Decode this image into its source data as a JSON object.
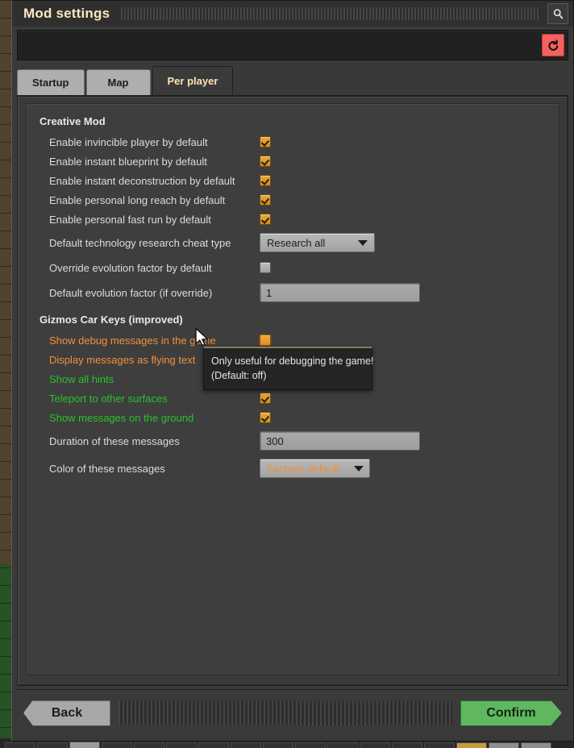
{
  "window": {
    "title": "Mod settings",
    "search_icon": "search-icon",
    "reset_icon": "reset-undo-icon"
  },
  "tabs": [
    {
      "label": "Startup",
      "active": false
    },
    {
      "label": "Map",
      "active": false
    },
    {
      "label": "Per player",
      "active": true
    }
  ],
  "groups": [
    {
      "title": "Creative Mod",
      "settings": [
        {
          "label": "Enable invincible player by default",
          "type": "checkbox",
          "state": "checked",
          "color": "default"
        },
        {
          "label": "Enable instant blueprint by default",
          "type": "checkbox",
          "state": "checked",
          "color": "default"
        },
        {
          "label": "Enable instant deconstruction by default",
          "type": "checkbox",
          "state": "checked",
          "color": "default"
        },
        {
          "label": "Enable personal long reach by default",
          "type": "checkbox",
          "state": "checked",
          "color": "default"
        },
        {
          "label": "Enable personal fast run by default",
          "type": "checkbox",
          "state": "checked",
          "color": "default"
        },
        {
          "label": "Default technology research cheat type",
          "type": "dropdown",
          "value": "Research all",
          "value_color": "default",
          "width": 143
        },
        {
          "label": "Override evolution factor by default",
          "type": "checkbox",
          "state": "unchecked",
          "color": "default"
        },
        {
          "label": "Default evolution factor (if override)",
          "type": "textbox",
          "value": "1"
        }
      ]
    },
    {
      "title": "Gizmos Car Keys (improved)",
      "settings": [
        {
          "label": "Show debug messages in the game",
          "type": "checkbox",
          "state": "hover",
          "color": "orange"
        },
        {
          "label": "Display messages as flying text",
          "type": "checkbox",
          "state": "hover",
          "color": "orange"
        },
        {
          "label": "Show all hints",
          "type": "checkbox",
          "state": "checked",
          "color": "green"
        },
        {
          "label": "Teleport to other surfaces",
          "type": "checkbox",
          "state": "checked",
          "color": "green"
        },
        {
          "label": "Show messages on the ground",
          "type": "checkbox",
          "state": "checked",
          "color": "green"
        },
        {
          "label": "Duration of these messages",
          "type": "textbox",
          "value": "300"
        },
        {
          "label": "Color of these messages",
          "type": "dropdown",
          "value": "Factorio default",
          "value_color": "orange",
          "width": 137
        }
      ]
    }
  ],
  "tooltip": {
    "line1": "Only useful for debugging the game!",
    "line2": "(Default: off)"
  },
  "footer": {
    "back_label": "Back",
    "confirm_label": "Confirm"
  },
  "colors": {
    "accent_orange": "#f0903a",
    "accent_green": "#28c328",
    "checkbox_gold": "#e8a93c",
    "confirm_green": "#5fb85f",
    "reset_red": "#f4615f",
    "title_cream": "#ffe6c0"
  }
}
